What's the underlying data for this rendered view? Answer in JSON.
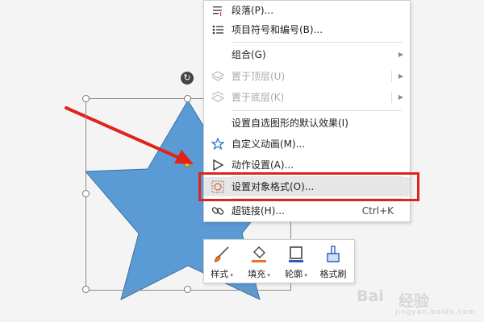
{
  "context_menu": {
    "items": [
      {
        "label": "段落(P)...",
        "icon": "paragraph-icon"
      },
      {
        "label": "项目符号和编号(B)...",
        "icon": "bullet-list-icon"
      },
      {
        "label": "组合(G)",
        "icon": "",
        "submenu": true
      },
      {
        "label": "置于顶层(U)",
        "icon": "bring-to-front-icon",
        "disabled": true,
        "submenu": true
      },
      {
        "label": "置于底层(K)",
        "icon": "send-to-back-icon",
        "disabled": true,
        "submenu": true
      },
      {
        "label": "设置自选图形的默认效果(I)",
        "icon": ""
      },
      {
        "label": "自定义动画(M)...",
        "icon": "custom-animation-icon"
      },
      {
        "label": "动作设置(A)...",
        "icon": "action-settings-icon"
      },
      {
        "label": "设置对象格式(O)...",
        "icon": "format-object-icon",
        "highlighted": true
      },
      {
        "label": "超链接(H)...",
        "icon": "hyperlink-icon",
        "shortcut": "Ctrl+K"
      }
    ]
  },
  "mini_toolbar": {
    "buttons": [
      {
        "label": "样式",
        "icon": "style-brush-icon",
        "dropdown": true
      },
      {
        "label": "填充",
        "icon": "fill-bucket-icon",
        "dropdown": true,
        "accent": "#e8742b"
      },
      {
        "label": "轮廓",
        "icon": "outline-icon",
        "dropdown": true,
        "accent": "#2f5fb3"
      },
      {
        "label": "格式刷",
        "icon": "format-painter-icon",
        "dropdown": false
      }
    ]
  },
  "watermark": {
    "text": "经验",
    "logo": "Bai",
    "sub": "jingyan.baidu.com"
  },
  "colors": {
    "star_fill": "#5b9bd5",
    "star_stroke": "#3e6f9e",
    "highlight": "#e0241b",
    "arrow": "#e0241b"
  }
}
